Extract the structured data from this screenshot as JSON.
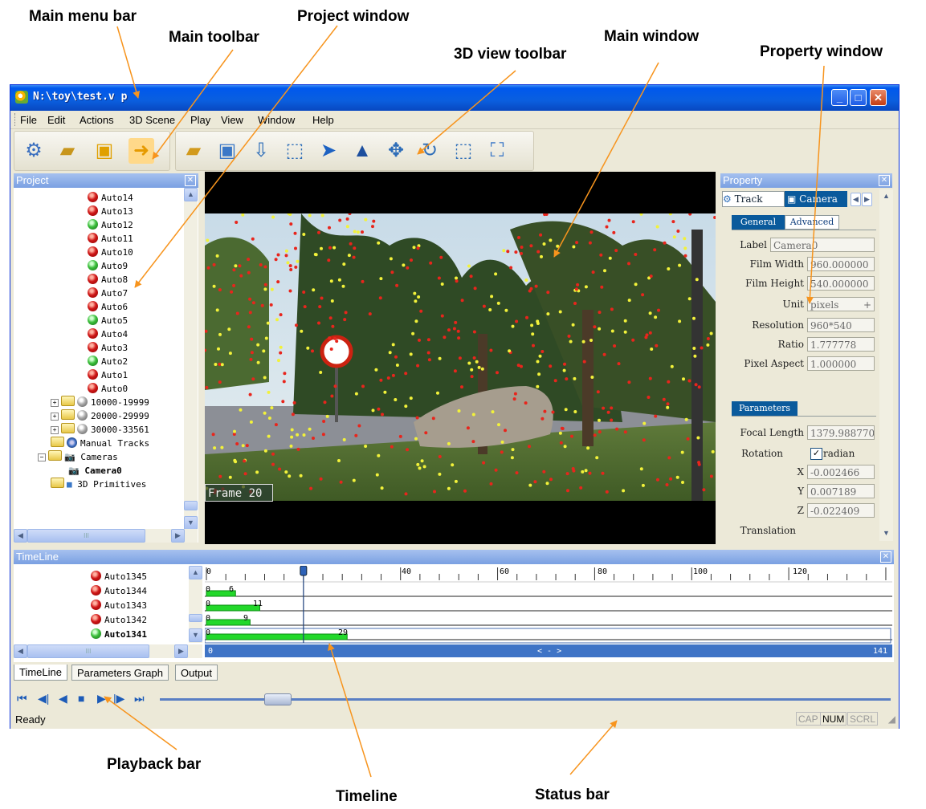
{
  "callouts": {
    "main_menu_bar": "Main menu bar",
    "main_toolbar": "Main toolbar",
    "project_window": "Project window",
    "main_window": "Main window",
    "view3d_toolbar": "3D view toolbar",
    "property_window": "Property window",
    "playback_bar": "Playback bar",
    "timeline": "Timeline",
    "status_bar": "Status bar"
  },
  "window": {
    "title": "N:\\toy\\test.v p"
  },
  "menu": [
    "File",
    "Edit",
    "Actions",
    "3D Scene",
    "Play",
    "View",
    "Window",
    "Help"
  ],
  "main_toolbar_icons": [
    "new-icon",
    "open-film-icon",
    "save-icon",
    "export-arrow-icon"
  ],
  "view3d_toolbar_icons": [
    "open-icon",
    "save-3d-icon",
    "import-icon",
    "select-icon",
    "pointer-icon",
    "up-icon",
    "move-icon",
    "rotate-icon",
    "box-icon",
    "scene-icon"
  ],
  "project": {
    "title": "Project",
    "tracks": [
      "Auto14",
      "Auto13",
      "Auto12",
      "Auto11",
      "Auto10",
      "Auto9",
      "Auto8",
      "Auto7",
      "Auto6",
      "Auto5",
      "Auto4",
      "Auto3",
      "Auto2",
      "Auto1",
      "Auto0"
    ],
    "track_colors": [
      "red",
      "red",
      "green",
      "red",
      "red",
      "green",
      "red",
      "red",
      "red",
      "green",
      "red",
      "red",
      "green",
      "red",
      "red"
    ],
    "groups": [
      "10000-19999",
      "20000-29999",
      "30000-33561"
    ],
    "manual_tracks": "Manual Tracks",
    "cameras": "Cameras",
    "camera0": "Camera0",
    "primitives": "3D Primitives",
    "hscroll_grip": "III"
  },
  "viewer": {
    "frame_label": "Frame 20"
  },
  "property": {
    "title": "Property",
    "tabs": [
      "Track",
      "Camera"
    ],
    "subtabs": [
      "General",
      "Advanced"
    ],
    "fields": [
      {
        "label": "Label",
        "value": "Camera0"
      },
      {
        "label": "Film Width",
        "value": "960.000000"
      },
      {
        "label": "Film Height",
        "value": "540.000000"
      },
      {
        "label": "Unit",
        "value": "pixels"
      },
      {
        "label": "Resolution",
        "value": "960*540"
      },
      {
        "label": "Ratio",
        "value": "1.777778"
      },
      {
        "label": "Pixel Aspect",
        "value": "1.000000"
      }
    ],
    "parameters_tab": "Parameters",
    "focal_length_label": "Focal Length",
    "focal_length_value": "1379.988770",
    "rotation_label": "Rotation",
    "radian_label": "radian",
    "x_label": "X",
    "x_value": "-0.002466",
    "y_label": "Y",
    "y_value": "0.007189",
    "z_label": "Z",
    "z_value": "-0.022409",
    "translation_label": "Translation"
  },
  "timeline": {
    "title": "TimeLine",
    "tracks": [
      "Auto1345",
      "Auto1344",
      "Auto1343",
      "Auto1342",
      "Auto1341"
    ],
    "track_colors": [
      "red",
      "red",
      "red",
      "red",
      "green"
    ],
    "ticks": [
      "0",
      "40",
      "60",
      "80",
      "100",
      "120"
    ],
    "current_frame": "20",
    "bars": [
      {
        "start": "0",
        "end": "6"
      },
      {
        "start": "0",
        "end": "11"
      },
      {
        "start": "0",
        "end": "9"
      },
      {
        "start": "0",
        "end": "29"
      }
    ],
    "range_start": "0",
    "range_mid": "< - >",
    "range_end": "141",
    "hscroll_grip": "III"
  },
  "bottom_tabs": [
    "TimeLine",
    "Parameters Graph",
    "Output"
  ],
  "status": {
    "text": "Ready",
    "indicators": [
      "CAP",
      "NUM",
      "SCRL"
    ]
  }
}
